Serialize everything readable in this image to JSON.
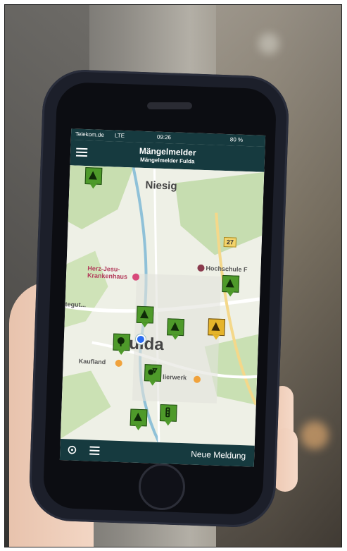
{
  "status": {
    "carrier": "Telekom.de",
    "network": "LTE",
    "time": "09:26",
    "battery": "80 %"
  },
  "header": {
    "title": "Mängelmelder",
    "subtitle": "Mängelmelder Fulda"
  },
  "map": {
    "places": [
      "Niesig",
      "Fulda"
    ],
    "pois": {
      "hospital": "Herz-Jesu-\nKrankenhaus",
      "school": "Hochschule F",
      "tegut": "tegut...",
      "kaufland": "Kaufland",
      "werk": "lierwerk"
    },
    "road_number": "27"
  },
  "toolbar": {
    "new_report": "Neue Meldung"
  },
  "icons": {
    "menu": "hamburger-icon",
    "locate": "crosshair-icon",
    "list": "list-icon"
  },
  "colors": {
    "header": "#163a3f",
    "marker": "#4e9a2a",
    "warning_marker": "#e5b42a"
  }
}
